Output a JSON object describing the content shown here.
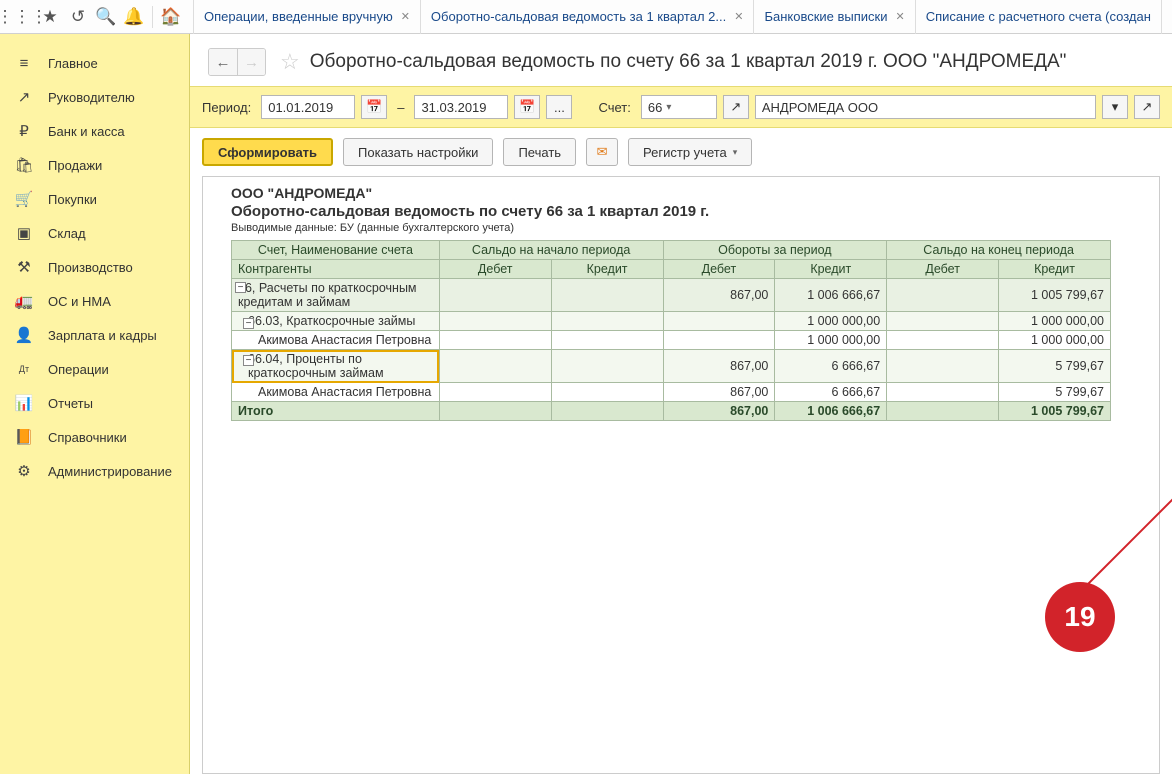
{
  "tabs": [
    {
      "label": "Операции, введенные вручную",
      "closable": true
    },
    {
      "label": "Оборотно-сальдовая ведомость за 1 квартал 2...",
      "closable": true
    },
    {
      "label": "Банковские выписки",
      "closable": true
    },
    {
      "label": "Списание с расчетного счета (создан",
      "closable": false
    }
  ],
  "sidebar": [
    {
      "icon": "≡",
      "label": "Главное"
    },
    {
      "icon": "↗",
      "label": "Руководителю"
    },
    {
      "icon": "₽",
      "label": "Банк и касса"
    },
    {
      "icon": "🛍",
      "label": "Продажи"
    },
    {
      "icon": "🛒",
      "label": "Покупки"
    },
    {
      "icon": "▣",
      "label": "Склад"
    },
    {
      "icon": "⚒",
      "label": "Производство"
    },
    {
      "icon": "🚛",
      "label": "ОС и НМА"
    },
    {
      "icon": "👤",
      "label": "Зарплата и кадры"
    },
    {
      "icon": "Дт",
      "label": "Операции"
    },
    {
      "icon": "📊",
      "label": "Отчеты"
    },
    {
      "icon": "📙",
      "label": "Справочники"
    },
    {
      "icon": "⚙",
      "label": "Администрирование"
    }
  ],
  "page_title": "Оборотно-сальдовая ведомость по счету 66 за 1 квартал 2019 г. ООО \"АНДРОМЕДА\"",
  "filters": {
    "period_label": "Период:",
    "date_from": "01.01.2019",
    "date_to": "31.03.2019",
    "dash": "–",
    "ellipsis": "...",
    "account_label": "Счет:",
    "account": "66",
    "org": "АНДРОМЕДА ООО"
  },
  "actions": {
    "generate": "Сформировать",
    "show_settings": "Показать настройки",
    "print": "Печать",
    "register": "Регистр учета"
  },
  "report": {
    "org_line": "ООО \"АНДРОМЕДА\"",
    "title": "Оборотно-сальдовая ведомость по счету 66 за 1 квартал 2019 г.",
    "subtitle": "Выводимые данные: БУ (данные бухгалтерского учета)",
    "headers": {
      "acct": "Счет, Наименование счета",
      "counterparty": "Контрагенты",
      "open": "Сальдо на начало периода",
      "turn": "Обороты за период",
      "close": "Сальдо на конец периода",
      "debit": "Дебет",
      "credit": "Кредит"
    },
    "rows": [
      {
        "type": "sec1",
        "name": "66, Расчеты по краткосрочным кредитам и займам",
        "open_d": "",
        "open_c": "",
        "turn_d": "867,00",
        "turn_c": "1 006 666,67",
        "close_d": "",
        "close_c": "1 005 799,67"
      },
      {
        "type": "sec2",
        "name": "66.03, Краткосрочные займы",
        "open_d": "",
        "open_c": "",
        "turn_d": "",
        "turn_c": "1 000 000,00",
        "close_d": "",
        "close_c": "1 000 000,00"
      },
      {
        "type": "detail",
        "name": "Акимова Анастасия Петровна",
        "open_d": "",
        "open_c": "",
        "turn_d": "",
        "turn_c": "1 000 000,00",
        "close_d": "",
        "close_c": "1 000 000,00"
      },
      {
        "type": "sec2",
        "name": "66.04, Проценты по краткосрочным займам",
        "open_d": "",
        "open_c": "",
        "turn_d": "867,00",
        "turn_c": "6 666,67",
        "close_d": "",
        "close_c": "5 799,67",
        "highlight": true
      },
      {
        "type": "detail",
        "name": "Акимова Анастасия Петровна",
        "open_d": "",
        "open_c": "",
        "turn_d": "867,00",
        "turn_c": "6 666,67",
        "close_d": "",
        "close_c": "5 799,67"
      }
    ],
    "total": {
      "label": "Итого",
      "open_d": "",
      "open_c": "",
      "turn_d": "867,00",
      "turn_c": "1 006 666,67",
      "close_d": "",
      "close_c": "1 005 799,67"
    }
  },
  "annotation": {
    "number": "19"
  }
}
